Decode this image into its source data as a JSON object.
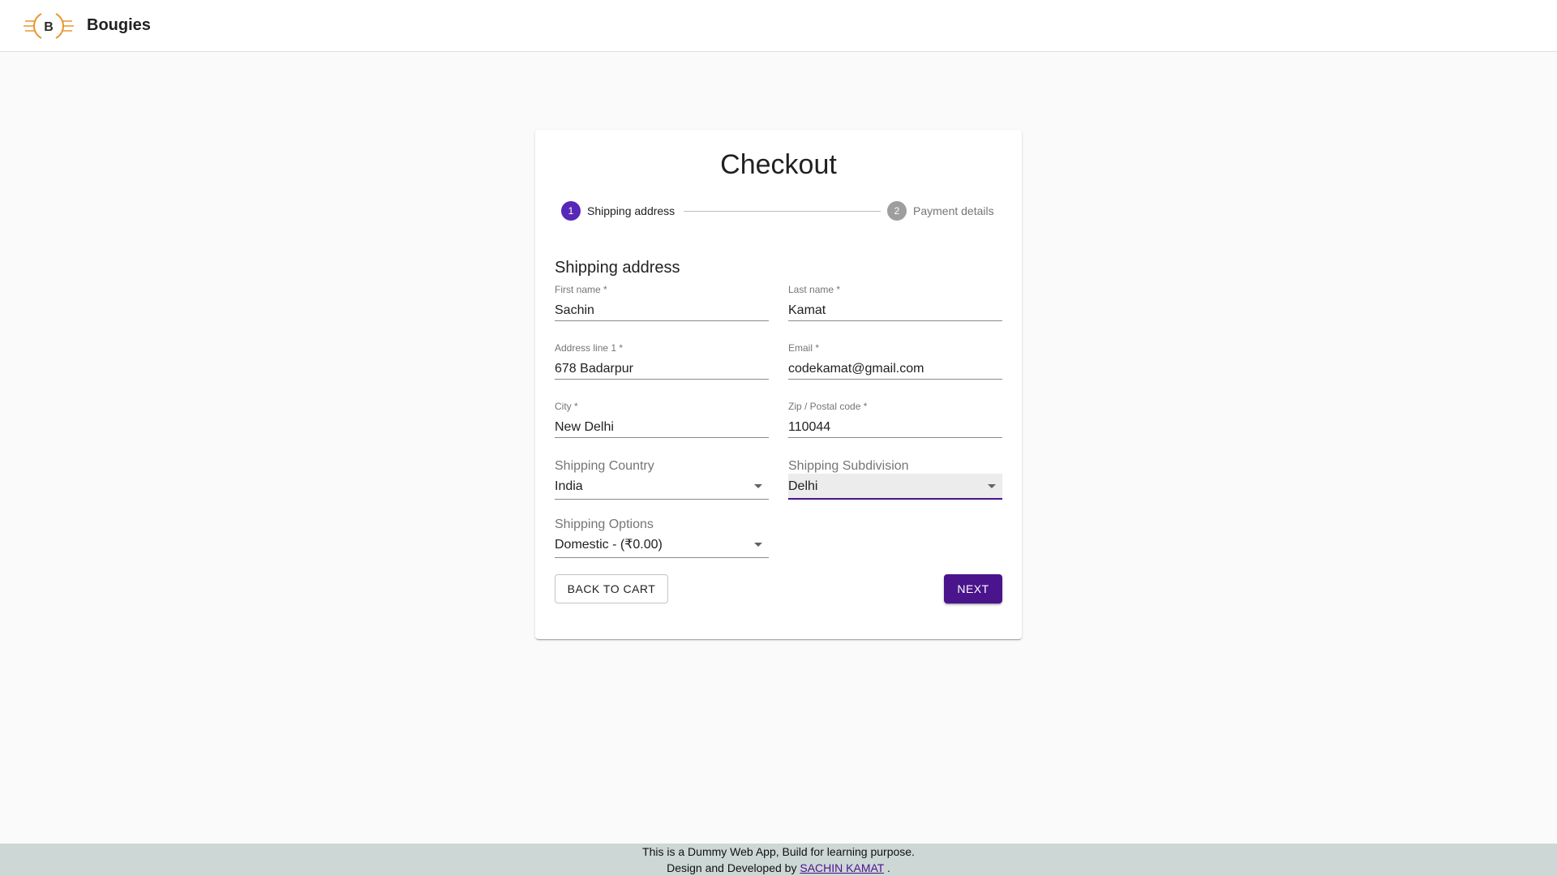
{
  "header": {
    "logo_letter": "B",
    "brand": "Bougies",
    "accent_color": "#e8952f"
  },
  "checkout": {
    "title": "Checkout",
    "steps": [
      {
        "number": "1",
        "label": "Shipping address",
        "state": "active"
      },
      {
        "number": "2",
        "label": "Payment details",
        "state": "inactive"
      }
    ],
    "section_title": "Shipping address",
    "fields": {
      "first_name": {
        "label": "First name *",
        "value": "Sachin"
      },
      "last_name": {
        "label": "Last name *",
        "value": "Kamat"
      },
      "address1": {
        "label": "Address line 1 *",
        "value": "678 Badarpur"
      },
      "email": {
        "label": "Email *",
        "value": "codekamat@gmail.com"
      },
      "city": {
        "label": "City *",
        "value": "New Delhi"
      },
      "zip": {
        "label": "Zip / Postal code *",
        "value": "110044"
      }
    },
    "selects": {
      "country": {
        "label": "Shipping Country",
        "value": "India"
      },
      "subdivision": {
        "label": "Shipping Subdivision",
        "value": "Delhi"
      },
      "options": {
        "label": "Shipping Options",
        "value": "Domestic - (₹0.00)"
      }
    },
    "buttons": {
      "back": "Back to cart",
      "next": "Next"
    },
    "colors": {
      "primary": "#4a148c",
      "step_active": "#5727b8",
      "step_inactive": "#9e9e9e"
    }
  },
  "footer": {
    "line1": "This is a Dummy Web App, Build for learning purpose.",
    "line2_prefix": "Design and Developed by",
    "author_link": "SACHIN KAMAT",
    "line2_suffix": "."
  }
}
